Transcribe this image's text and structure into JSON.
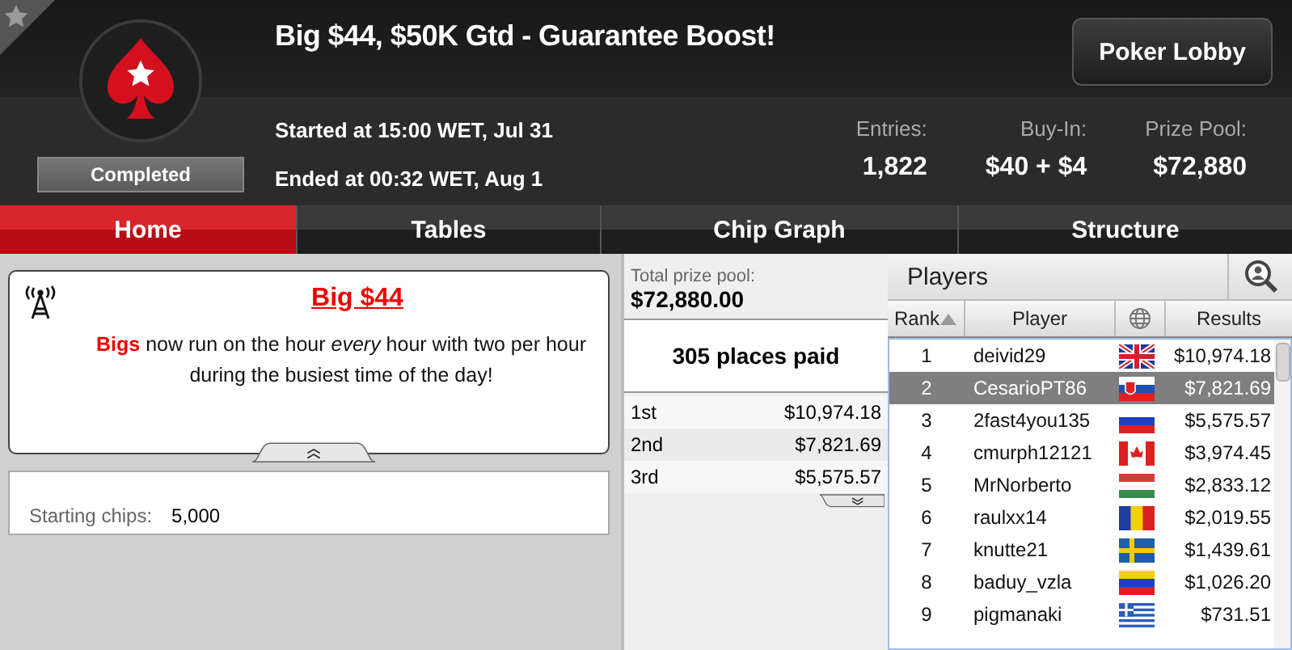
{
  "header": {
    "favorite": false,
    "status": "Completed",
    "title": "Big $44, $50K Gtd - Guarantee Boost!",
    "started": "Started at 15:00 WET, Jul 31",
    "ended": "Ended at 00:32 WET, Aug 1",
    "lobby_button": "Poker Lobby",
    "stats": [
      {
        "label": "Entries:",
        "value": "1,822"
      },
      {
        "label": "Buy-In:",
        "value": "$40 + $4"
      },
      {
        "label": "Prize Pool:",
        "value": "$72,880"
      }
    ]
  },
  "tabs": [
    {
      "label": "Home",
      "selected": true
    },
    {
      "label": "Tables",
      "selected": false
    },
    {
      "label": "Chip Graph",
      "selected": false
    },
    {
      "label": "Structure",
      "selected": false
    }
  ],
  "announcement": {
    "title": "Big $44",
    "text": "**Bigs** now run on the hour *every* hour with two per hour during the busiest time of the day!"
  },
  "starting_chips": {
    "label": "Starting chips:",
    "value": "5,000"
  },
  "prizes": {
    "total_label": "Total prize pool:",
    "total": "$72,880.00",
    "places": "305 places paid",
    "rows": [
      {
        "place": "1st",
        "amount": "$10,974.18"
      },
      {
        "place": "2nd",
        "amount": "$7,821.69"
      },
      {
        "place": "3rd",
        "amount": "$5,575.57"
      }
    ]
  },
  "players": {
    "title": "Players",
    "columns": [
      {
        "label": "Rank",
        "kind": "sorted_ascending"
      },
      {
        "label": "Player",
        "kind": "text"
      },
      {
        "kind": "globe"
      },
      {
        "label": "Results",
        "kind": "text"
      }
    ],
    "rows": [
      {
        "rank": "1",
        "name": "deivid29",
        "kind": "gb",
        "result": "$10,974.18",
        "selected": false
      },
      {
        "rank": "2",
        "name": "CesarioPT86",
        "kind": "sk",
        "result": "$7,821.69",
        "selected": true
      },
      {
        "rank": "3",
        "name": "2fast4you135",
        "kind": "ru",
        "result": "$5,575.57",
        "selected": false
      },
      {
        "rank": "4",
        "name": "cmurph12121",
        "kind": "ca",
        "result": "$3,974.45",
        "selected": false
      },
      {
        "rank": "5",
        "name": "MrNorberto",
        "kind": "hu",
        "result": "$2,833.12",
        "selected": false
      },
      {
        "rank": "6",
        "name": "raulxx14",
        "kind": "ro",
        "result": "$2,019.55",
        "selected": false
      },
      {
        "rank": "7",
        "name": "knutte21",
        "kind": "se",
        "result": "$1,439.61",
        "selected": false
      },
      {
        "rank": "8",
        "name": "baduy_vzla",
        "kind": "ve",
        "result": "$1,026.20",
        "selected": false
      },
      {
        "rank": "9",
        "name": "pigmanaki",
        "kind": "gr",
        "result": "$731.51",
        "selected": false
      }
    ]
  }
}
